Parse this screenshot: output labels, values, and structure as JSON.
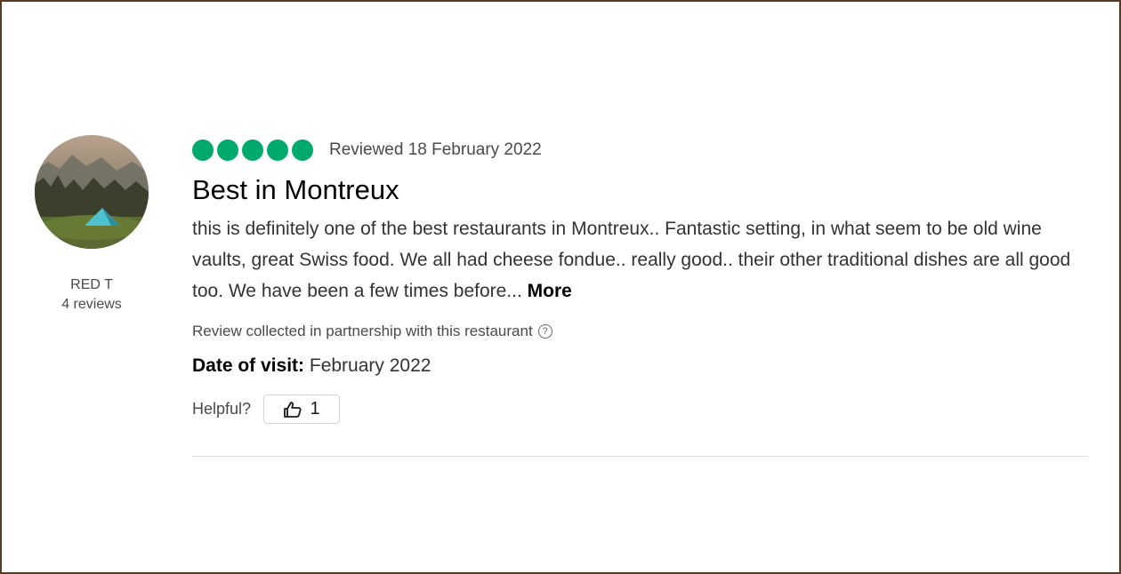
{
  "reviewer": {
    "name": "RED T",
    "review_count": "4 reviews"
  },
  "review": {
    "rating": 5,
    "rating_max": 5,
    "rating_color": "#00aa6c",
    "reviewed_date": "Reviewed 18 February 2022",
    "title": "Best in Montreux",
    "body": "this is definitely one of the best restaurants in Montreux.. Fantastic setting, in what seem to be old wine vaults, great Swiss food. We all had cheese fondue.. really good.. their other traditional dishes are all good too. We have been a few times before...",
    "more_label": "More",
    "partnership_text": "Review collected in partnership with this restaurant",
    "help_icon": "question-circle-icon",
    "date_of_visit_label": "Date of visit:",
    "date_of_visit_value": "February 2022",
    "helpful_label": "Helpful?",
    "helpful_icon": "thumbs-up-icon",
    "helpful_count": "1"
  }
}
